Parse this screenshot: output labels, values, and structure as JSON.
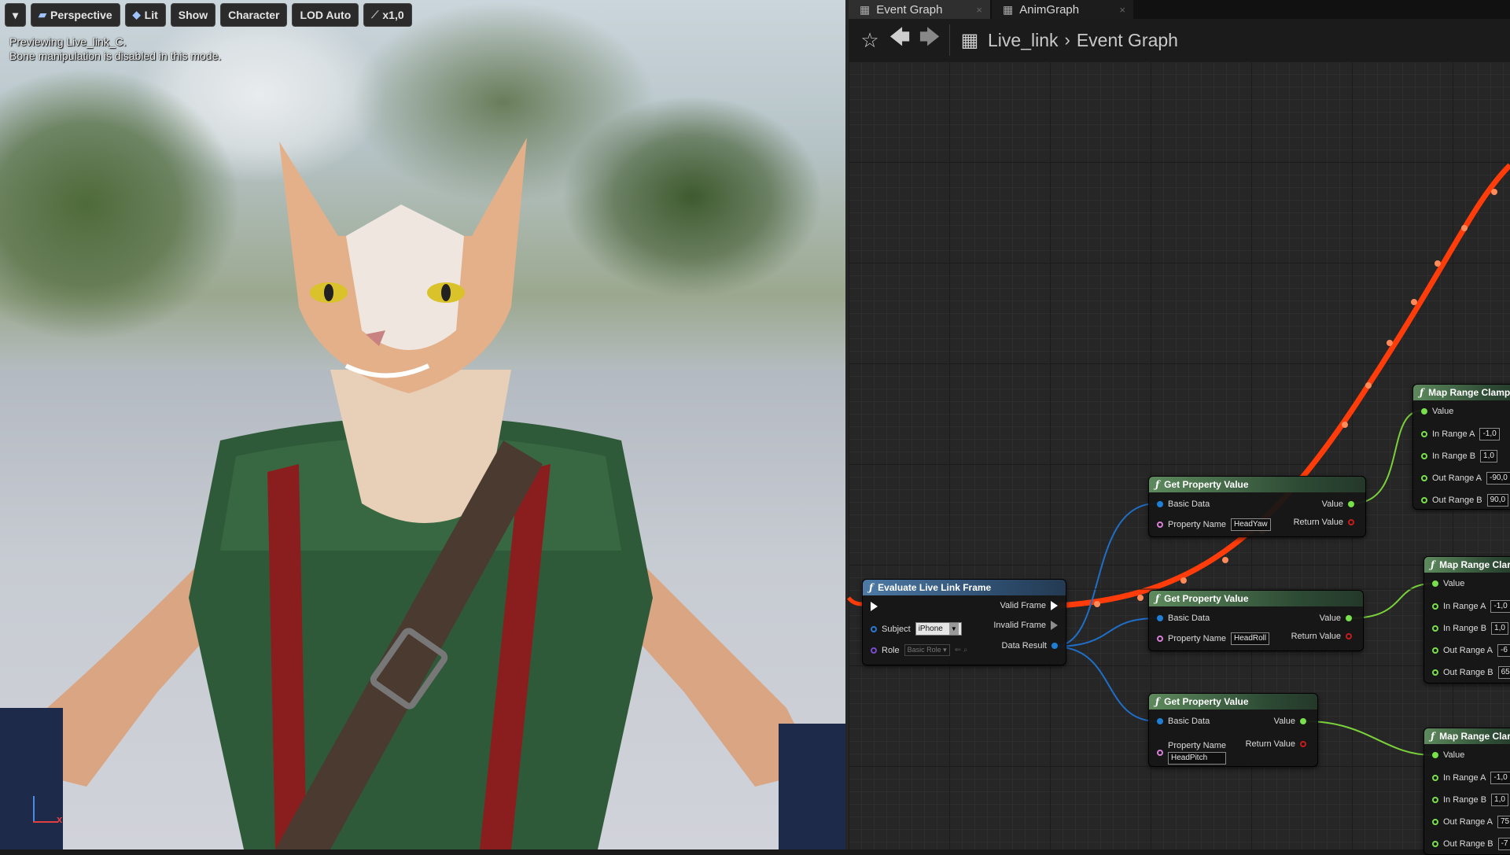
{
  "viewport": {
    "toolbar": {
      "menu_label": "▾",
      "perspective": "Perspective",
      "lit": "Lit",
      "show": "Show",
      "character": "Character",
      "lod": "LOD Auto",
      "speed": "x1,0"
    },
    "notice_line1": "Previewing Live_link_C.",
    "notice_line2": "Bone manipulation is disabled in this mode.",
    "axis_x_label": "x"
  },
  "tabs": [
    {
      "label": "Event Graph"
    },
    {
      "label": "AnimGraph"
    }
  ],
  "breadcrumb": {
    "root": "Live_link",
    "current": "Event Graph"
  },
  "nodes": {
    "evaluate": {
      "title": "Evaluate Live Link Frame",
      "subject_label": "Subject",
      "subject_value": "iPhone",
      "role_label": "Role",
      "role_value": "Basic Role",
      "valid_frame": "Valid Frame",
      "invalid_frame": "Invalid Frame",
      "data_result": "Data Result"
    },
    "gpv1": {
      "title": "Get Property Value",
      "basic_data": "Basic Data",
      "value": "Value",
      "property_name": "Property Name",
      "property_value": "HeadYaw",
      "return_value": "Return Value"
    },
    "gpv2": {
      "title": "Get Property Value",
      "basic_data": "Basic Data",
      "value": "Value",
      "property_name": "Property Name",
      "property_value": "HeadRoll",
      "return_value": "Return Value"
    },
    "gpv3": {
      "title": "Get Property Value",
      "basic_data": "Basic Data",
      "value": "Value",
      "property_name": "Property Name",
      "property_value": "HeadPitch",
      "return_value": "Return Value"
    },
    "mrc1": {
      "title": "Map Range Clamp",
      "value": "Value",
      "in_a": "In Range A",
      "in_a_v": "-1,0",
      "in_b": "In Range B",
      "in_b_v": "1,0",
      "out_a": "Out Range A",
      "out_a_v": "-90,0",
      "out_b": "Out Range B",
      "out_b_v": "90,0"
    },
    "mrc2": {
      "title": "Map Range Clar",
      "value": "Value",
      "in_a": "In Range A",
      "in_a_v": "-1,0",
      "in_b": "In Range B",
      "in_b_v": "1,0",
      "out_a": "Out Range A",
      "out_a_v": "-6",
      "out_b": "Out Range B",
      "out_b_v": "65"
    },
    "mrc3": {
      "title": "Map Range Clar",
      "value": "Value",
      "in_a": "In Range A",
      "in_a_v": "-1,0",
      "in_b": "In Range B",
      "in_b_v": "1,0",
      "out_a": "Out Range A",
      "out_a_v": "75",
      "out_b": "Out Range B",
      "out_b_v": "-7"
    }
  },
  "colors": {
    "exec_wire": "#ff3c0a",
    "struct_wire": "#1f6fc8",
    "float_wire": "#7ad23a",
    "function_header": "#5d8a5d",
    "pure_header": "#4d7aa6"
  }
}
